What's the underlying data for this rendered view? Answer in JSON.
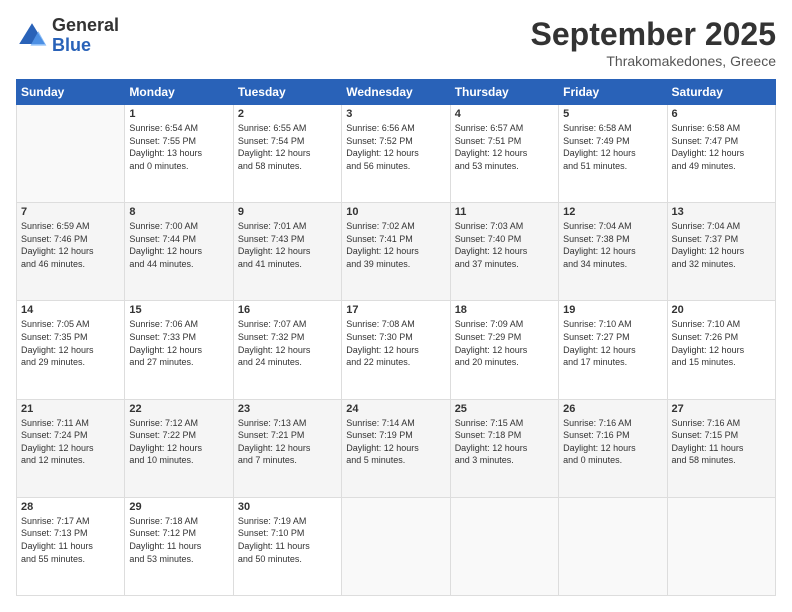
{
  "header": {
    "logo_line1": "General",
    "logo_line2": "Blue",
    "month": "September 2025",
    "location": "Thrakomakedones, Greece"
  },
  "days_of_week": [
    "Sunday",
    "Monday",
    "Tuesday",
    "Wednesday",
    "Thursday",
    "Friday",
    "Saturday"
  ],
  "weeks": [
    [
      {
        "day": "",
        "info": ""
      },
      {
        "day": "1",
        "info": "Sunrise: 6:54 AM\nSunset: 7:55 PM\nDaylight: 13 hours\nand 0 minutes."
      },
      {
        "day": "2",
        "info": "Sunrise: 6:55 AM\nSunset: 7:54 PM\nDaylight: 12 hours\nand 58 minutes."
      },
      {
        "day": "3",
        "info": "Sunrise: 6:56 AM\nSunset: 7:52 PM\nDaylight: 12 hours\nand 56 minutes."
      },
      {
        "day": "4",
        "info": "Sunrise: 6:57 AM\nSunset: 7:51 PM\nDaylight: 12 hours\nand 53 minutes."
      },
      {
        "day": "5",
        "info": "Sunrise: 6:58 AM\nSunset: 7:49 PM\nDaylight: 12 hours\nand 51 minutes."
      },
      {
        "day": "6",
        "info": "Sunrise: 6:58 AM\nSunset: 7:47 PM\nDaylight: 12 hours\nand 49 minutes."
      }
    ],
    [
      {
        "day": "7",
        "info": "Sunrise: 6:59 AM\nSunset: 7:46 PM\nDaylight: 12 hours\nand 46 minutes."
      },
      {
        "day": "8",
        "info": "Sunrise: 7:00 AM\nSunset: 7:44 PM\nDaylight: 12 hours\nand 44 minutes."
      },
      {
        "day": "9",
        "info": "Sunrise: 7:01 AM\nSunset: 7:43 PM\nDaylight: 12 hours\nand 41 minutes."
      },
      {
        "day": "10",
        "info": "Sunrise: 7:02 AM\nSunset: 7:41 PM\nDaylight: 12 hours\nand 39 minutes."
      },
      {
        "day": "11",
        "info": "Sunrise: 7:03 AM\nSunset: 7:40 PM\nDaylight: 12 hours\nand 37 minutes."
      },
      {
        "day": "12",
        "info": "Sunrise: 7:04 AM\nSunset: 7:38 PM\nDaylight: 12 hours\nand 34 minutes."
      },
      {
        "day": "13",
        "info": "Sunrise: 7:04 AM\nSunset: 7:37 PM\nDaylight: 12 hours\nand 32 minutes."
      }
    ],
    [
      {
        "day": "14",
        "info": "Sunrise: 7:05 AM\nSunset: 7:35 PM\nDaylight: 12 hours\nand 29 minutes."
      },
      {
        "day": "15",
        "info": "Sunrise: 7:06 AM\nSunset: 7:33 PM\nDaylight: 12 hours\nand 27 minutes."
      },
      {
        "day": "16",
        "info": "Sunrise: 7:07 AM\nSunset: 7:32 PM\nDaylight: 12 hours\nand 24 minutes."
      },
      {
        "day": "17",
        "info": "Sunrise: 7:08 AM\nSunset: 7:30 PM\nDaylight: 12 hours\nand 22 minutes."
      },
      {
        "day": "18",
        "info": "Sunrise: 7:09 AM\nSunset: 7:29 PM\nDaylight: 12 hours\nand 20 minutes."
      },
      {
        "day": "19",
        "info": "Sunrise: 7:10 AM\nSunset: 7:27 PM\nDaylight: 12 hours\nand 17 minutes."
      },
      {
        "day": "20",
        "info": "Sunrise: 7:10 AM\nSunset: 7:26 PM\nDaylight: 12 hours\nand 15 minutes."
      }
    ],
    [
      {
        "day": "21",
        "info": "Sunrise: 7:11 AM\nSunset: 7:24 PM\nDaylight: 12 hours\nand 12 minutes."
      },
      {
        "day": "22",
        "info": "Sunrise: 7:12 AM\nSunset: 7:22 PM\nDaylight: 12 hours\nand 10 minutes."
      },
      {
        "day": "23",
        "info": "Sunrise: 7:13 AM\nSunset: 7:21 PM\nDaylight: 12 hours\nand 7 minutes."
      },
      {
        "day": "24",
        "info": "Sunrise: 7:14 AM\nSunset: 7:19 PM\nDaylight: 12 hours\nand 5 minutes."
      },
      {
        "day": "25",
        "info": "Sunrise: 7:15 AM\nSunset: 7:18 PM\nDaylight: 12 hours\nand 3 minutes."
      },
      {
        "day": "26",
        "info": "Sunrise: 7:16 AM\nSunset: 7:16 PM\nDaylight: 12 hours\nand 0 minutes."
      },
      {
        "day": "27",
        "info": "Sunrise: 7:16 AM\nSunset: 7:15 PM\nDaylight: 11 hours\nand 58 minutes."
      }
    ],
    [
      {
        "day": "28",
        "info": "Sunrise: 7:17 AM\nSunset: 7:13 PM\nDaylight: 11 hours\nand 55 minutes."
      },
      {
        "day": "29",
        "info": "Sunrise: 7:18 AM\nSunset: 7:12 PM\nDaylight: 11 hours\nand 53 minutes."
      },
      {
        "day": "30",
        "info": "Sunrise: 7:19 AM\nSunset: 7:10 PM\nDaylight: 11 hours\nand 50 minutes."
      },
      {
        "day": "",
        "info": ""
      },
      {
        "day": "",
        "info": ""
      },
      {
        "day": "",
        "info": ""
      },
      {
        "day": "",
        "info": ""
      }
    ]
  ]
}
